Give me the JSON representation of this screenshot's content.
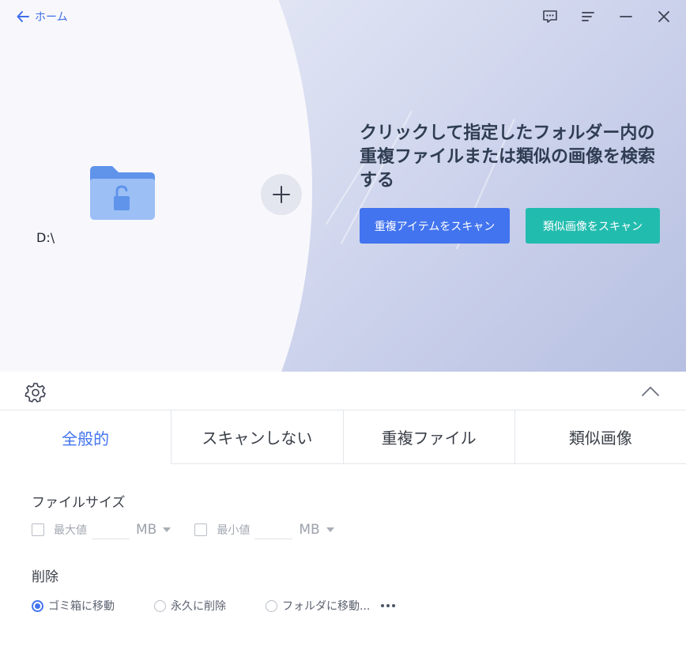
{
  "header": {
    "back_label": "ホーム"
  },
  "titlebar": {
    "icons": [
      "feedback-icon",
      "menu-icon",
      "minimize-icon",
      "close-icon"
    ]
  },
  "source": {
    "path": "D:\\",
    "folder_icon": "folder-lock-icon"
  },
  "hero": {
    "headline": "クリックして指定したフォルダー内の重複ファイルまたは類似の画像を検索する",
    "scan_duplicates_label": "重複アイテムをスキャン",
    "scan_similar_label": "類似画像をスキャン"
  },
  "tabs": [
    {
      "label": "全般的",
      "active": true
    },
    {
      "label": "スキャンしない",
      "active": false
    },
    {
      "label": "重複ファイル",
      "active": false
    },
    {
      "label": "類似画像",
      "active": false
    }
  ],
  "settings": {
    "filesize_title": "ファイルサイズ",
    "max_label": "最大値",
    "max_unit": "MB",
    "min_label": "最小値",
    "min_unit": "MB",
    "delete_title": "削除",
    "delete_options": [
      "ゴミ箱に移動",
      "永久に削除",
      "フォルダに移動..."
    ],
    "delete_selected": 0
  },
  "colors": {
    "accent": "#4274ef",
    "teal": "#22bcaf"
  }
}
